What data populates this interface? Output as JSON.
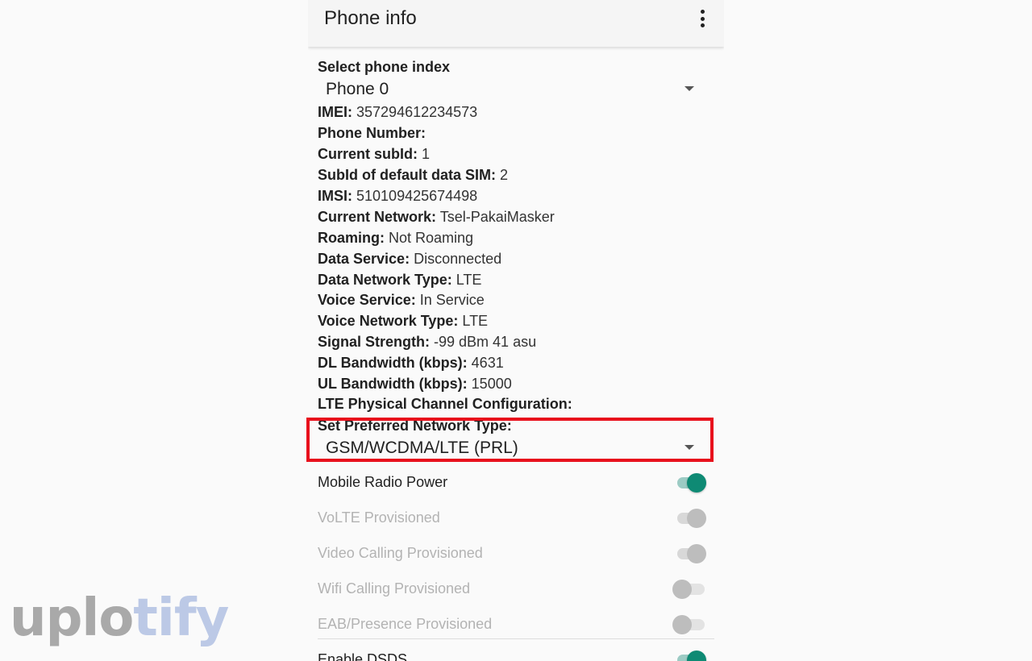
{
  "appbar": {
    "title": "Phone info",
    "menu_icon": "more-vert-icon"
  },
  "phone_index": {
    "label": "Select phone index",
    "selected": "Phone 0"
  },
  "info": [
    {
      "key": "IMEI:",
      "value": "357294612234573"
    },
    {
      "key": "Phone Number:",
      "value": ""
    },
    {
      "key": "Current subId:",
      "value": "1"
    },
    {
      "key": "SubId of default data SIM:",
      "value": "2"
    },
    {
      "key": "IMSI:",
      "value": "510109425674498"
    },
    {
      "key": "Current Network:",
      "value": "Tsel-PakaiMasker"
    },
    {
      "key": "Roaming:",
      "value": "Not Roaming"
    },
    {
      "key": "Data Service:",
      "value": "Disconnected"
    },
    {
      "key": "Data Network Type:",
      "value": "LTE"
    },
    {
      "key": "Voice Service:",
      "value": "In Service"
    },
    {
      "key": "Voice Network Type:",
      "value": "LTE"
    },
    {
      "key": "Signal Strength:",
      "value": "-99 dBm   41 asu"
    },
    {
      "key": "DL Bandwidth (kbps):",
      "value": "4631"
    },
    {
      "key": "UL Bandwidth (kbps):",
      "value": "15000"
    },
    {
      "key": "LTE Physical Channel Configuration:",
      "value": ""
    }
  ],
  "preferred_network": {
    "label": "Set Preferred Network Type:",
    "selected": "GSM/WCDMA/LTE (PRL)"
  },
  "switches": [
    {
      "label": "Mobile Radio Power",
      "enabled": true,
      "checked": true
    },
    {
      "label": "VoLTE Provisioned",
      "enabled": false,
      "checked": true
    },
    {
      "label": "Video Calling Provisioned",
      "enabled": false,
      "checked": true
    },
    {
      "label": "Wifi Calling Provisioned",
      "enabled": false,
      "checked": false
    },
    {
      "label": "EAB/Presence Provisioned",
      "enabled": false,
      "checked": false
    },
    {
      "label": "Enable DSDS",
      "enabled": true,
      "checked": true
    }
  ],
  "watermark": {
    "text": "uplotify"
  },
  "colors": {
    "accent": "#0e8a74",
    "highlight": "#e8101c"
  }
}
